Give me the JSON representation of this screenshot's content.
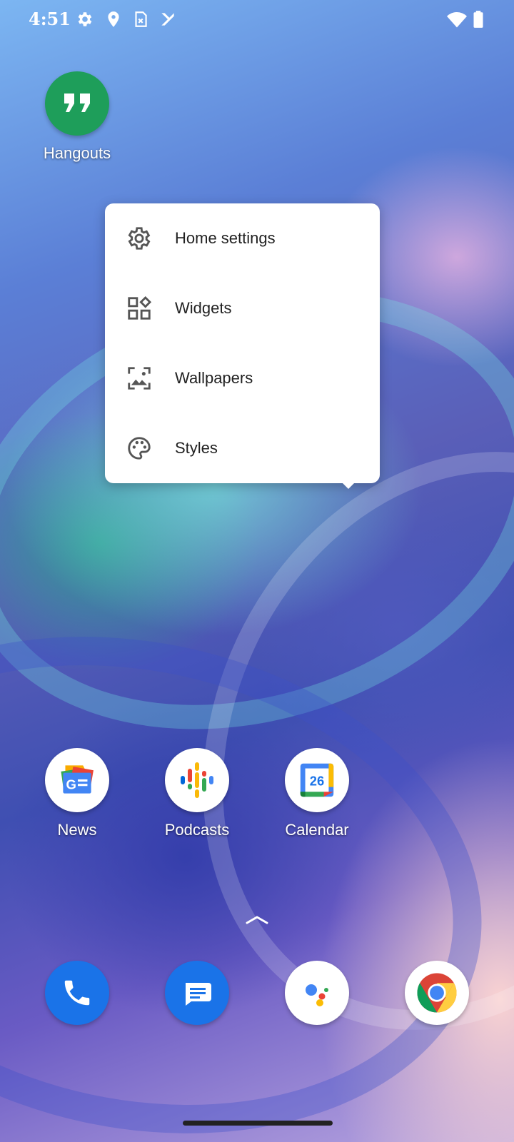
{
  "status_bar": {
    "time": "4:51",
    "left_icons": [
      "settings-icon",
      "location-icon",
      "sim-card-icon",
      "check-icon"
    ],
    "right_icons": [
      "wifi-icon",
      "battery-icon"
    ]
  },
  "home_apps": [
    {
      "label": "Hangouts",
      "icon": "hangouts-icon",
      "color": "#1E9E5A"
    }
  ],
  "popup_menu": {
    "items": [
      {
        "label": "Home settings",
        "icon": "gear-icon"
      },
      {
        "label": "Widgets",
        "icon": "widgets-icon"
      },
      {
        "label": "Wallpapers",
        "icon": "wallpaper-icon"
      },
      {
        "label": "Styles",
        "icon": "palette-icon"
      }
    ]
  },
  "app_row": [
    {
      "label": "News",
      "icon": "google-news-icon"
    },
    {
      "label": "Podcasts",
      "icon": "google-podcasts-icon"
    },
    {
      "label": "Calendar",
      "icon": "google-calendar-icon",
      "day": "26"
    }
  ],
  "dock": [
    {
      "name": "phone",
      "icon": "phone-icon",
      "color": "#1A73E8"
    },
    {
      "name": "messages",
      "icon": "messages-icon",
      "color": "#1A73E8"
    },
    {
      "name": "assistant",
      "icon": "google-assistant-icon"
    },
    {
      "name": "chrome",
      "icon": "chrome-icon"
    }
  ]
}
